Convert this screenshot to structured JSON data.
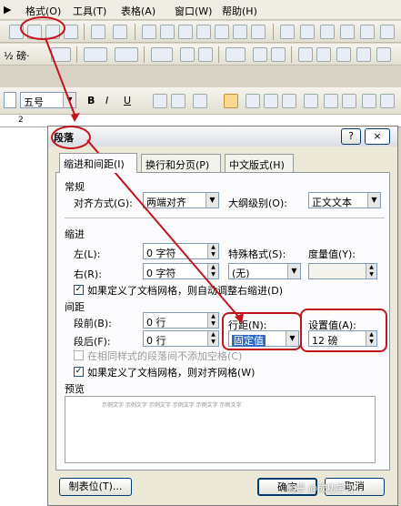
{
  "menu": {
    "format": "格式(O)",
    "tools": "工具(T)",
    "table": "表格(A)",
    "window": "窗口(W)",
    "help": "帮助(H)"
  },
  "toolbar2": {
    "style_value": "½ 磅·",
    "size_value": "五号"
  },
  "dialog": {
    "title": "段落",
    "help": "?",
    "close": "×",
    "tabs": [
      "缩进和间距(I)",
      "换行和分页(P)",
      "中文版式(H)"
    ],
    "general": {
      "section": "常规",
      "align_label": "对齐方式(G):",
      "align_value": "两端对齐",
      "outline_label": "大纲级别(O):",
      "outline_value": "正文文本"
    },
    "indent": {
      "section": "缩进",
      "left_label": "左(L):",
      "left_value": "0 字符",
      "right_label": "右(R):",
      "right_value": "0 字符",
      "special_label": "特殊格式(S):",
      "special_value": "(无)",
      "by_label": "度量值(Y):",
      "grid_check": "如果定义了文档网格，则自动调整右缩进(D)"
    },
    "spacing": {
      "section": "间距",
      "before_label": "段前(B):",
      "before_value": "0 行",
      "after_label": "段后(F):",
      "after_value": "0 行",
      "line_label": "行距(N):",
      "line_value": "固定值",
      "at_label": "设置值(A):",
      "at_value": "12 磅",
      "nospace_check": "在相同样式的段落间不添加空格(C)",
      "grid_check": "如果定义了文档网格，则对齐网格(W)"
    },
    "preview": {
      "section": "预览",
      "text": "示例文字 示例文字 示例文字 示例文字 示例文字 示例文字"
    },
    "buttons": {
      "tabs": "制表位(T)...",
      "ok": "确定",
      "cancel": "取消"
    }
  },
  "watermark": "知乎 @成功学习",
  "colors": {
    "annotation": "#c3131d"
  }
}
